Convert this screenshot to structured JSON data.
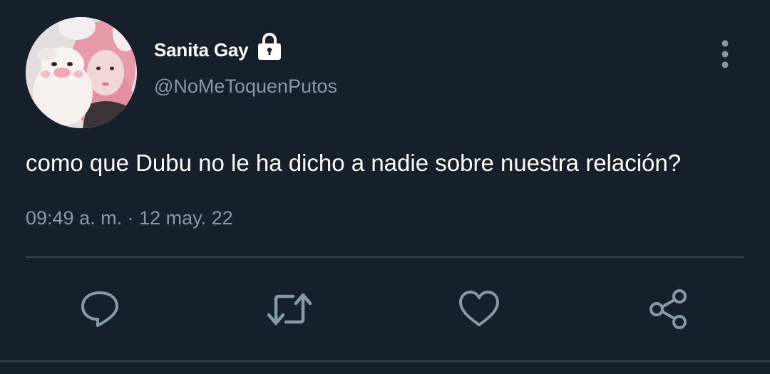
{
  "tweet": {
    "author": {
      "display_name": "Sanita Gay",
      "handle": "@NoMeToquenPutos",
      "protected_icon": "lock-icon",
      "avatar": "profile-photo"
    },
    "text": "como que Dubu no le ha dicho a nadie sobre nuestra relación?",
    "timestamp": "09:49 a. m. · 12 may. 22",
    "more_icon": "more-vertical-icon"
  },
  "actions": [
    {
      "name": "reply",
      "icon": "reply-icon"
    },
    {
      "name": "retweet",
      "icon": "retweet-icon"
    },
    {
      "name": "like",
      "icon": "heart-icon"
    },
    {
      "name": "share",
      "icon": "share-icon"
    }
  ],
  "colors": {
    "background": "#15202b",
    "primary_text": "#ffffff",
    "secondary_text": "#8899a6",
    "divider": "#38444d",
    "icon": "#8899a6"
  }
}
